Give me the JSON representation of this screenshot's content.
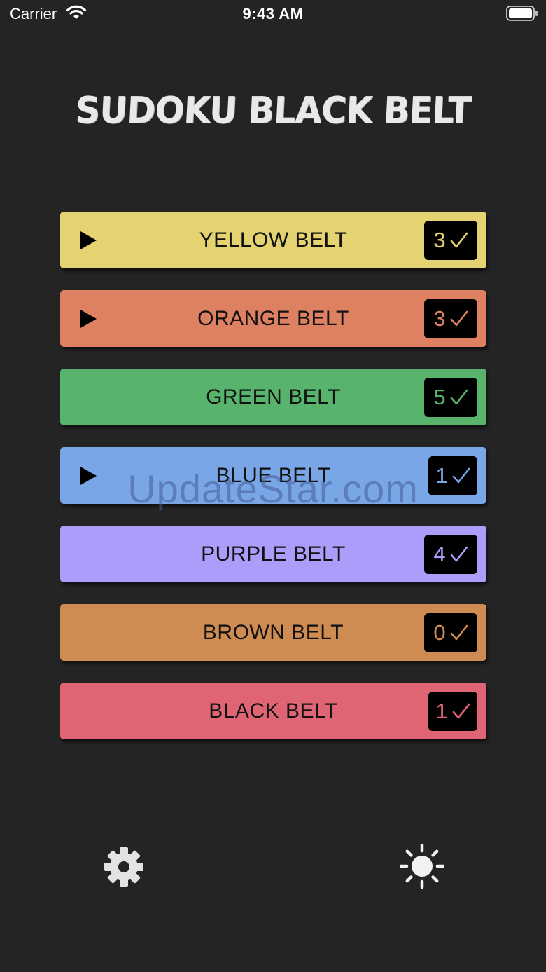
{
  "status_bar": {
    "carrier": "Carrier",
    "time": "9:43 AM"
  },
  "title": "SUDOKU BLACK BELT",
  "belts": [
    {
      "label": "YELLOW BELT",
      "count": "3",
      "color": "#e5d372",
      "count_color": "#e5d372",
      "has_play": true
    },
    {
      "label": "ORANGE BELT",
      "count": "3",
      "color": "#dd8162",
      "count_color": "#dd8162",
      "has_play": true
    },
    {
      "label": "GREEN BELT",
      "count": "5",
      "color": "#58b46c",
      "count_color": "#58b46c",
      "has_play": false
    },
    {
      "label": "BLUE BELT",
      "count": "1",
      "color": "#78a6e7",
      "count_color": "#78a6e7",
      "has_play": true
    },
    {
      "label": "PURPLE BELT",
      "count": "4",
      "color": "#ab9efb",
      "count_color": "#ab9efb",
      "has_play": false
    },
    {
      "label": "BROWN BELT",
      "count": "0",
      "color": "#cf8c52",
      "count_color": "#cf8c52",
      "has_play": false
    },
    {
      "label": "BLACK BELT",
      "count": "1",
      "color": "#e06574",
      "count_color": "#e06574",
      "has_play": false
    }
  ],
  "watermark": "UpdateStar.com",
  "icons": {
    "settings": "gear-icon",
    "theme": "sun-icon",
    "play": "play-icon",
    "check": "checkmark-icon"
  }
}
